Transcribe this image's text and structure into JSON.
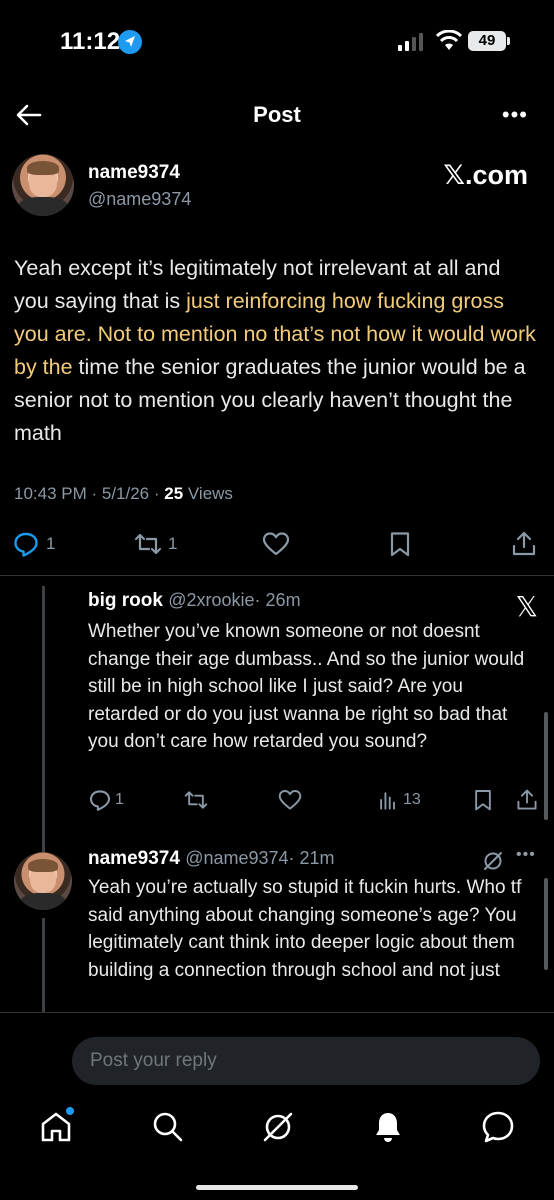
{
  "status_bar": {
    "time": "11:12",
    "battery": "49"
  },
  "header": {
    "title": "Post"
  },
  "main_post": {
    "author_name": "name9374",
    "author_handle": "@name9374",
    "watermark": "𝕏.com",
    "text_parts": [
      "Yeah except it’s legitimately not irrelevant at all and you saying that is ",
      "just reinforcing how fucking gross you are. Not to mention no that’s not how it would work by the",
      " time the senior graduates the junior would be a senior not to mention you clearly haven’t thought the math"
    ],
    "timestamp": "10:43 PM · 5/1/26 · ",
    "views_count": "25",
    "views_label": " Views",
    "reply_count": "1",
    "repost_count": "1"
  },
  "replies": [
    {
      "author_name": "big rook",
      "author_handle": "@2xrookie",
      "time": "· 26m",
      "text": "Whether you’ve known someone or not doesnt change their age dumbass.. And so the junior would still be in high school like I just said? Are you retarded or do you just wanna be right so bad that you don’t care how retarded you sound?",
      "reply_count": "1",
      "views": "13"
    },
    {
      "author_name": "name9374",
      "author_handle": "@name9374",
      "time": "· 21m",
      "text": "Yeah you’re actually so stupid it fuckin hurts. Who tf said anything about changing someone’s age? You legitimately cant think into deeper logic about them building a connection through school and not just"
    }
  ],
  "reply_box": {
    "placeholder": "Post your reply"
  },
  "colors": {
    "accent": "#1d9bf0",
    "highlight": "#f2cc7a",
    "muted": "#8b98a5"
  }
}
